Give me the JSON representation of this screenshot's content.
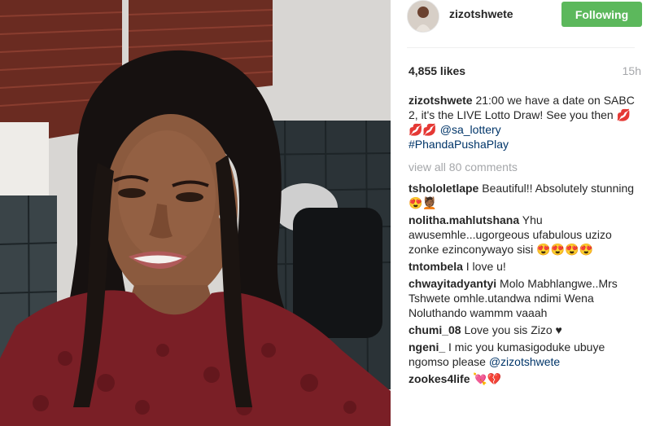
{
  "post": {
    "username": "zizotshwete",
    "follow_label": "Following",
    "likes": "4,855 likes",
    "time": "15h"
  },
  "caption": {
    "user": "zizotshwete",
    "text": "21:00 we have a date on SABC 2, it's the LIVE Lotto Draw! See you then",
    "lips": "💋💋💋",
    "mention": "@sa_lottery",
    "hashtag": "#PhandaPushaPlay"
  },
  "view_all": "view all 80 comments",
  "comments": [
    {
      "user": "tshololetlape",
      "text": "Beautiful!! Absolutely stunning",
      "emoji": "😍💆🏾"
    },
    {
      "user": "nolitha.mahlutshana",
      "text": "Yhu awusemhle...ugorgeous ufabulous uzizo zonke ezinconywayo sisi",
      "emoji": "😍😍😍😍"
    },
    {
      "user": "tntombela",
      "text": "I love u!",
      "emoji": ""
    },
    {
      "user": "chwayitadyantyi",
      "text": "Molo Mabhlangwe..Mrs Tshwete omhle.utandwa ndimi Wena Noluthando wammm vaaah",
      "emoji": ""
    },
    {
      "user": "chumi_08",
      "text": "Love you sis Zizo",
      "emoji": "♥"
    },
    {
      "user": "ngeni_",
      "text": "I mic you kumasigoduke ubuye ngomso please",
      "mention": "@zizotshwete",
      "emoji": ""
    },
    {
      "user": "zookes4life",
      "text": "",
      "emoji": "💘💔"
    }
  ]
}
